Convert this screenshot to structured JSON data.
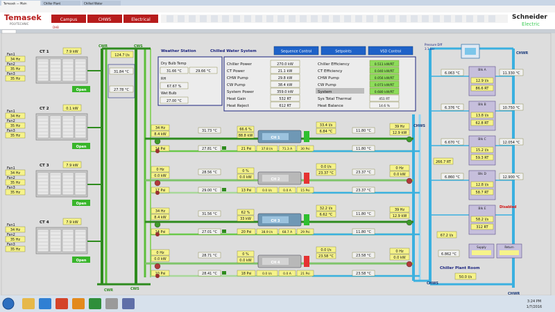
{
  "browser": {
    "tabs": [
      "Temasek — Main",
      "Chiller Plant",
      "Chilled Water"
    ],
    "toolbar_links": [
      "Home",
      "Menu"
    ]
  },
  "header": {
    "logo_name": "Temasek",
    "logo_sub": "POLYTECHNIC",
    "nav": [
      "Campus",
      "CHWS",
      "Electrical"
    ],
    "nav_sub": "DHB",
    "brand": "Schneider",
    "brand_sub": "Electric",
    "colors": {
      "nav_red": "#b71c1c",
      "brand_green": "#3dcd58"
    }
  },
  "top_tabs": [
    "Weather Station",
    "Chilled Water System"
  ],
  "top_buttons": [
    "Sequence Control",
    "Setpoints",
    "VSD Control"
  ],
  "weather": {
    "rows": [
      {
        "label": "Dry Bulb Temp",
        "v1": "31.66 °C",
        "v2": "29.66 °C"
      },
      {
        "label": "RH",
        "v1": "67.67 %"
      },
      {
        "label": "Wet Bulb",
        "v1": "27.00 °C"
      }
    ]
  },
  "plant_summary": {
    "left": [
      {
        "label": "Chiller Power",
        "value": "270.0 kW"
      },
      {
        "label": "CT Power",
        "value": "21.1 kW"
      },
      {
        "label": "CHW Pump",
        "value": "29.8 kW"
      },
      {
        "label": "CW Pump",
        "value": "38.4 kW"
      },
      {
        "label": "System Power",
        "value": "359.0 kW"
      },
      {
        "label": "Heat Gain",
        "value": "532 RT"
      },
      {
        "label": "Heat Reject",
        "value": "612 RT"
      }
    ],
    "right": [
      {
        "label": "Chiller Efficiency",
        "value": "0.511 kW/RT"
      },
      {
        "label": "CT Efficiency",
        "value": "0.040 kW/RT"
      },
      {
        "label": "CHW Pump",
        "value": "0.056 kW/RT"
      },
      {
        "label": "CW Pump",
        "value": "0.073 kW/RT"
      },
      {
        "label": "System",
        "value": "0.680 kW/RT"
      },
      {
        "label": "Sys Total Thermal",
        "value": "451 RT"
      },
      {
        "label": "Heat Balance",
        "value": "14.6 %"
      }
    ]
  },
  "pipes": {
    "cwr_top": "CWR",
    "cws_top": "CWS",
    "cwr_bottom": "CWR",
    "cws_bottom": "CWS",
    "chws_right": "CHWS",
    "chwr_right": "CHWR",
    "chws_bottom": "CHWS",
    "chwr_bottom": "CHWR",
    "colors": {
      "cw": "#2e8b1e",
      "chw": "#3ab0e0"
    }
  },
  "cooling_towers": [
    {
      "label": "CT 1",
      "fans": [
        {
          "name": "Fan1",
          "hz": "34 Hz"
        },
        {
          "name": "Fan2",
          "hz": "35 Hz"
        },
        {
          "name": "Fan3",
          "hz": "35 Hz"
        }
      ],
      "power": "7.9 kW",
      "status": "Open"
    },
    {
      "label": "CT 2",
      "fans": [
        {
          "name": "Fan1",
          "hz": "34 Hz"
        },
        {
          "name": "Fan2",
          "hz": "35 Hz"
        },
        {
          "name": "Fan3",
          "hz": "35 Hz"
        }
      ],
      "power": "0.1 kW",
      "status": "Open"
    },
    {
      "label": "CT 3",
      "fans": [
        {
          "name": "Fan1",
          "hz": "34 Hz"
        },
        {
          "name": "Fan2",
          "hz": "35 Hz"
        },
        {
          "name": "Fan3",
          "hz": "35 Hz"
        }
      ],
      "power": "7.9 kW",
      "status": "Open"
    },
    {
      "label": "CT 4",
      "fans": [
        {
          "name": "Fan1",
          "hz": "34 Hz"
        },
        {
          "name": "Fan2",
          "hz": "35 Hz"
        },
        {
          "name": "Fan3",
          "hz": "35 Hz"
        }
      ],
      "power": "7.9 kW",
      "status": "Open"
    }
  ],
  "ct_header": {
    "flow": "124.7 l/s",
    "temp1": "31.84 °C",
    "temp2": "27.78 °C"
  },
  "chillers": [
    {
      "label": "CH 1",
      "state": "running",
      "cwp": {
        "hz": "34 Hz",
        "kw": "8.4 kW",
        "press": "14 Psi"
      },
      "cw_in": "31.73 °C",
      "cw_out": "27.81 °C",
      "valve": "21 Psi",
      "load": "66.6 %",
      "power": "88.8 kW",
      "cw_flow": "37.8 l/s",
      "amps": "71.3 A",
      "chw_press": "30 Psi",
      "chw_flow": "33.4 l/s",
      "chw_t1": "6.84 °C",
      "chw_t2": "11.80 °C",
      "chwp": {
        "hz": "39 Hz",
        "kw": "12.9 kW"
      }
    },
    {
      "label": "CH 2",
      "state": "stopped",
      "cwp": {
        "hz": "0 Hz",
        "kw": "0.0 kW",
        "press": "17 Psi"
      },
      "cw_in": "28.56 °C",
      "cw_out": "29.00 °C",
      "valve": "13 Psi",
      "load": "0 %",
      "power": "0.0 kW",
      "cw_flow": "0.0 l/s",
      "amps": "0.0 A",
      "chw_press": "15 Psi",
      "chw_flow": "0.0 l/s",
      "chw_t1": "23.37 °C",
      "chw_t2": "23.37 °C",
      "chwp": {
        "hz": "0 Hz",
        "kw": "0.0 kW"
      }
    },
    {
      "label": "CH 3",
      "state": "running",
      "cwp": {
        "hz": "34 Hz",
        "kw": "8.4 kW",
        "press": "14 Psi"
      },
      "cw_in": "31.56 °C",
      "cw_out": "27.01 °C",
      "valve": "20 Psi",
      "load": "62 %",
      "power": "33 kW",
      "cw_flow": "38.9 l/s",
      "amps": "68.7 A",
      "chw_press": "29 Psi",
      "chw_flow": "32.2 l/s",
      "chw_t1": "6.62 °C",
      "chw_t2": "11.80 °C",
      "chwp": {
        "hz": "39 Hz",
        "kw": "12.9 kW"
      }
    },
    {
      "label": "CH 4",
      "state": "stopped",
      "cwp": {
        "hz": "0 Hz",
        "kw": "0.0 kW",
        "press": "10 Psi"
      },
      "cw_in": "28.71 °C",
      "cw_out": "28.41 °C",
      "valve": "18 Psi",
      "load": "0 %",
      "power": "0.0 kW",
      "cw_flow": "0.0 l/s",
      "amps": "0.0 A",
      "chw_press": "21 Psi",
      "chw_flow": "0.0 l/s",
      "chw_t1": "23.58 °C",
      "chw_t2": "23.58 °C",
      "chwp": {
        "hz": "0 Hz",
        "kw": "0.0 kW"
      }
    }
  ],
  "loads": {
    "pressure_title": "Pressure Diff",
    "pressure_value": "3.1 bar",
    "blocks": [
      {
        "name": "Blk A",
        "left": "6.063 °C",
        "right": "11.330 °C",
        "v1": "12.9 l/s",
        "v2": "86.6 RT"
      },
      {
        "name": "Blk B",
        "left": "6.376 °C",
        "right": "10.750 °C",
        "v1": "13.8 l/s",
        "v2": "62.8 RT"
      },
      {
        "name": "Blk C",
        "left": "6.670 °C",
        "right": "12.054 °C",
        "v1": "15.2 l/s",
        "v2": "59.3 RT"
      },
      {
        "name": "Blk D",
        "left": "6.860 °C",
        "right": "12.900 °C",
        "v1": "12.8 l/s",
        "v2": "58.7 RT"
      },
      {
        "name": "Blk E",
        "left": "",
        "right": "",
        "v1": "58.2 l/s",
        "v2": "312 RT"
      }
    ],
    "left_rt": "266.7 RT",
    "alarm": "Disabled",
    "bypass": "67.2 l/s",
    "bottom_left": "6.862 °C",
    "room_title": "Chiller Plant Room",
    "room_value": "50.0 l/s",
    "small_panels": [
      "Supply",
      "Return"
    ]
  },
  "taskbar": {
    "start": "start-orb",
    "apps": [
      "folder",
      "ie",
      "chrome",
      "media",
      "excel",
      "calc",
      "app"
    ],
    "time": "3:24 PM",
    "date": "1/7/2016"
  }
}
